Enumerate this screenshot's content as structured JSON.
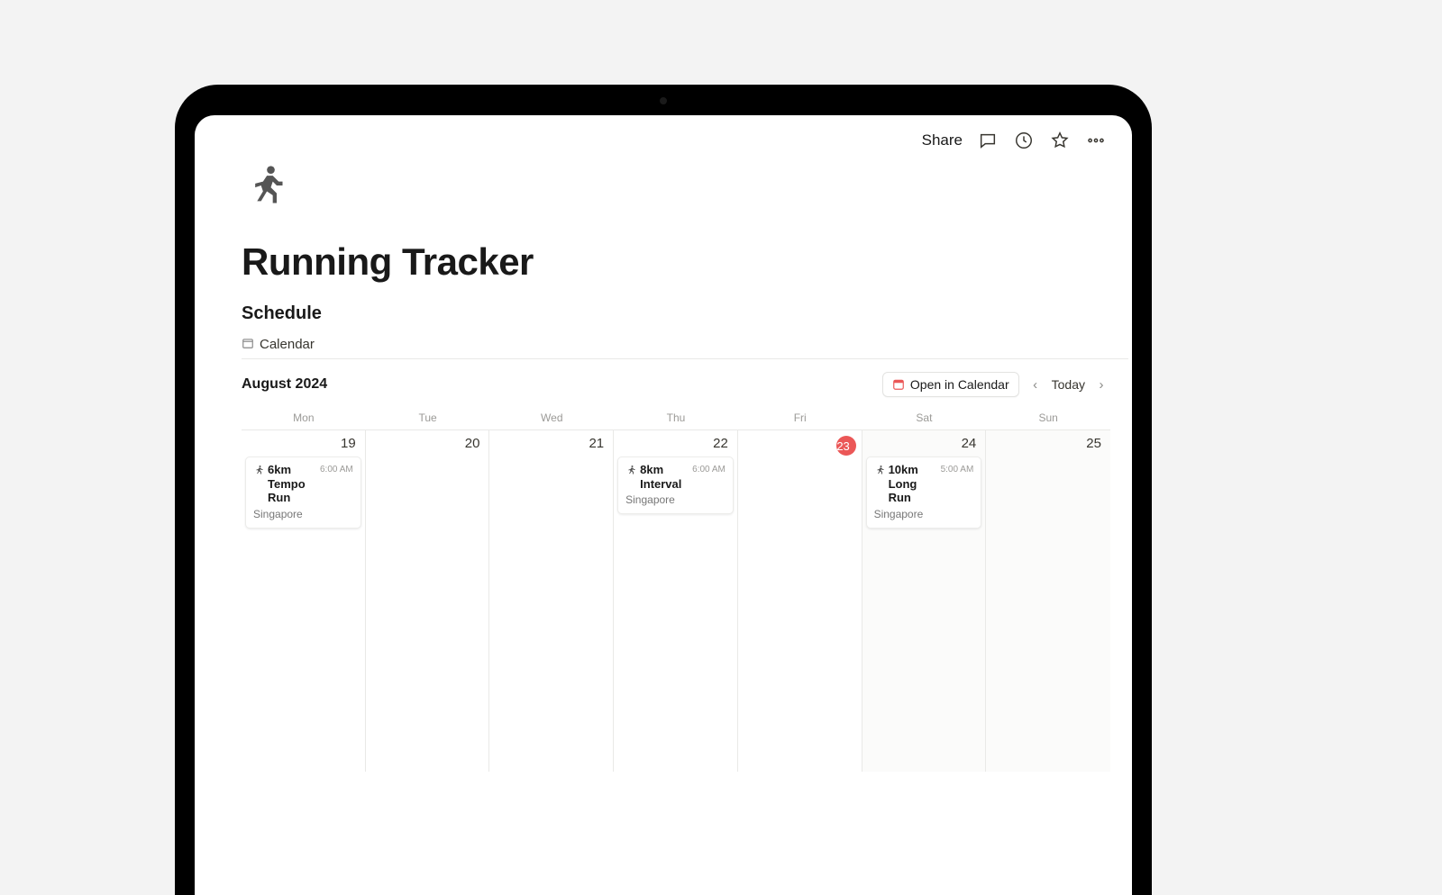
{
  "topbar": {
    "share_label": "Share"
  },
  "page": {
    "title": "Running Tracker",
    "section": "Schedule",
    "view_label": "Calendar"
  },
  "calendar": {
    "month_label": "August 2024",
    "open_label": "Open in Calendar",
    "today_label": "Today",
    "weekdays": [
      "Mon",
      "Tue",
      "Wed",
      "Thu",
      "Fri",
      "Sat",
      "Sun"
    ],
    "days": [
      {
        "num": "19",
        "today": false,
        "shade": false
      },
      {
        "num": "20",
        "today": false,
        "shade": false
      },
      {
        "num": "21",
        "today": false,
        "shade": false
      },
      {
        "num": "22",
        "today": false,
        "shade": false
      },
      {
        "num": "23",
        "today": true,
        "shade": false
      },
      {
        "num": "24",
        "today": false,
        "shade": true
      },
      {
        "num": "25",
        "today": false,
        "shade": true
      }
    ],
    "events": {
      "0": {
        "title": "6km Tempo Run",
        "time": "6:00 AM",
        "location": "Singapore"
      },
      "3": {
        "title": "8km Interval",
        "time": "6:00 AM",
        "location": "Singapore"
      },
      "5": {
        "title": "10km Long Run",
        "time": "5:00 AM",
        "location": "Singapore"
      }
    }
  }
}
